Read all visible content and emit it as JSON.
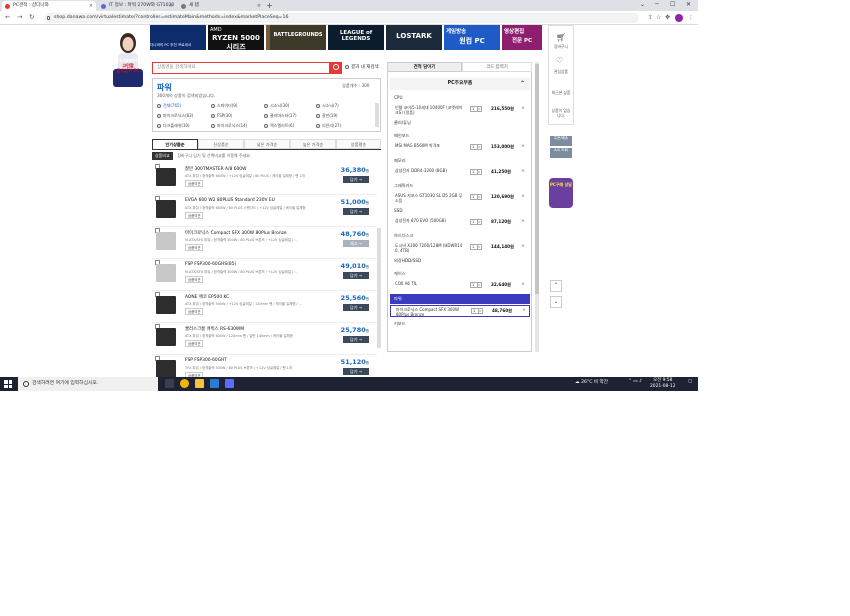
{
  "browser": {
    "tabs": [
      {
        "label": "PC견적 : 샵다나와",
        "color": "#e53935",
        "active": true
      },
      {
        "label": "IT 정보 : 파워 270W와 GT1030",
        "color": "#5c6bc0",
        "active": false
      },
      {
        "label": "새 탭",
        "color": "#777777",
        "active": false
      }
    ],
    "new_tab": "+",
    "url": "shop.danawa.com/virtualestimate/?controller=estimateMain&methods=index&marketPlaceSeq=16"
  },
  "banners": [
    {
      "top": "",
      "big": "",
      "color": "#0d2c6b"
    },
    {
      "top": "AMD",
      "big": "RYZEN 5000 시리즈",
      "color": "#111111"
    },
    {
      "top": "",
      "big": "",
      "color": "#7a5a3c"
    },
    {
      "top": "",
      "big": "BATTLEGROUNDS",
      "color": "#3e3a2a"
    },
    {
      "top": "",
      "big": "LEAGUE of LEGENDS",
      "color": "#0b1c2c"
    },
    {
      "top": "",
      "big": "LOSTARK",
      "color": "#1c2a3c"
    },
    {
      "top": "게임방송",
      "big": "원컴 PC",
      "color": "#1e5bc6"
    },
    {
      "top": "영상편집",
      "big": "전문 PC",
      "color": "#8e1f6f"
    }
  ],
  "banner_caption": "다나와의 PC 추천 프로세서",
  "ad_label": {
    "line1": "다나와표PC",
    "line2": "고민할",
    "line3": "필요없이 PC"
  },
  "search": {
    "placeholder": "상품명을 검색하세요.",
    "refine_label": "결과 내 재검색"
  },
  "category": {
    "title": "파워",
    "count_text": "300개의 상품이 검색되었습니다.",
    "sort_label": "상품개수 : 300",
    "filters": [
      [
        "전체(765)",
        "스파이더(9)",
        "시소닉(30)",
        "시소닉(7)"
      ],
      [
        "마이크로닉스(83)",
        "FSP(30)",
        "쿨러마스터(17)",
        "잘만(19)"
      ],
      [
        "다크플래쉬(30)",
        "마이크로닉스(14)",
        "맥스엘리트(6)",
        "리안리(27)"
      ]
    ]
  },
  "sort_tabs": [
    "인기상품순",
    "신상품순",
    "낮은 가격순",
    "높은 가격순",
    "상품평순"
  ],
  "compare": {
    "button": "상품비교",
    "text": "장바구니 담기 및 선택비교를 이용해 주세요."
  },
  "products": [
    {
      "name": "잘만 300TMASTER A/8 600W",
      "spec": "ATX 파워 / 정격출력 600W / +12V 싱글레일 / 80 PLUS / 케이블 일체형 / 팬 1개",
      "review": "상품의견",
      "price": "36,380",
      "unit": "원",
      "add": "담기",
      "light": false,
      "active": true
    },
    {
      "name": "EVGA 600 W2 80PLUS Standard 230V EU",
      "spec": "ATX 파워 / 정격출력 600W / 80 PLUS 스탠다드 / +12V 싱글레일 / 케이블 일체형",
      "review": "상품의견",
      "price": "51,000",
      "unit": "원",
      "add": "담기",
      "light": false,
      "active": true
    },
    {
      "name": "마이크로닉스 Compact SFX 300W 80Plus Bronze",
      "spec": "M-ATX/SFX 파워 / 정격출력 300W / 80 PLUS 브론즈 / +12V 싱글레일 / ...",
      "review": "상품의견",
      "price": "48,760",
      "unit": "원",
      "add": "재고",
      "light": true,
      "active": false
    },
    {
      "name": "FSP FSP300-60GHS(85)",
      "spec": "M-ATX/SFX 파워 / 정격출력 300W / 80 PLUS 브론즈 / +12V 싱글레일 / ...",
      "review": "상품의견",
      "price": "49,010",
      "unit": "원",
      "add": "담기",
      "light": true,
      "active": true
    },
    {
      "name": "AONE 에코 EP500 KC",
      "spec": "ATX 파워 / 정격출력 500W / +12V 싱글레일 / 120mm 팬 / 케이블 일체형 / ...",
      "review": "상품의견",
      "price": "25,560",
      "unit": "원",
      "add": "담기",
      "light": false,
      "active": true
    },
    {
      "name": "쿨러스크롬 큐빅스 RS-630WM",
      "spec": "ATX 파워 / 정격출력 630W / 120mm 팬 / 일반 140mm / 케이블 일체형",
      "review": "상품의견",
      "price": "25,780",
      "unit": "원",
      "add": "담기",
      "light": false,
      "active": true
    },
    {
      "name": "FSP FSP300-60GHT",
      "spec": "TFX 파워 / 정격출력 300W / 80 PLUS 브론즈 / +12V 싱글레일 / 팬 1개",
      "review": "상품의견",
      "price": "51,120",
      "unit": "원",
      "add": "담기",
      "light": false,
      "active": true
    }
  ],
  "right_panel": {
    "tab1": "견적 담아기",
    "tab2": "코드 입력기",
    "header": "PC주요부품",
    "sections": [
      {
        "label": "CPU",
        "item": {
          "name": "인텔 코어i5-10세대 10400F (코멧레이크S) (정품)",
          "qty": "1",
          "price": "216,550원"
        }
      },
      {
        "label": "쿨러/튜닝",
        "item": null
      },
      {
        "label": "메인보드",
        "item": {
          "name": "MSI MAG B560M 박격포",
          "qty": "1",
          "price": "153,000원"
        }
      },
      {
        "label": "메모리",
        "item": {
          "name": "삼성전자 DDR4-3200 (8GB)",
          "qty": "1",
          "price": "41,250원"
        }
      },
      {
        "label": "그래픽카드",
        "item": {
          "name": "ASUS 지포스 GT1030 SL D5 2GB 무소음",
          "qty": "1",
          "price": "120,690원"
        }
      },
      {
        "label": "SSD",
        "item": {
          "name": "삼성전자 870 EVO (500GB)",
          "qty": "1",
          "price": "87,120원"
        }
      },
      {
        "label": "하드디스크",
        "item": {
          "name": "도시바 X300 7200/128M (HDWR14 0, 4TB)",
          "qty": "1",
          "price": "144,140원"
        }
      },
      {
        "label": "외장HDD/SSD",
        "item": null
      },
      {
        "label": "케이스",
        "item": {
          "name": "COX A6 TIL",
          "qty": "1",
          "price": "32,640원"
        }
      },
      {
        "label": "파워",
        "item": {
          "name": "마이크로닉스 Compact SFX 300W 80Plus Bronze",
          "qty": "1",
          "price": "48,760원"
        },
        "highlight": true
      },
      {
        "label": "키보드",
        "item": null
      }
    ]
  },
  "quickbar": {
    "cart": "장바구니",
    "wish": "관심상품",
    "recent": "최근본 상품",
    "compare": "상품이 없습니다.",
    "btn1": "주문/배송",
    "btn2": "A/S 조회",
    "badge": "PC구매 상담"
  },
  "taskbar": {
    "search_placeholder": "검색하려면 여기에 입력하십시오.",
    "weather": "26°C 비 약간",
    "time": "오전 9:58",
    "date": "2021-08-12"
  }
}
